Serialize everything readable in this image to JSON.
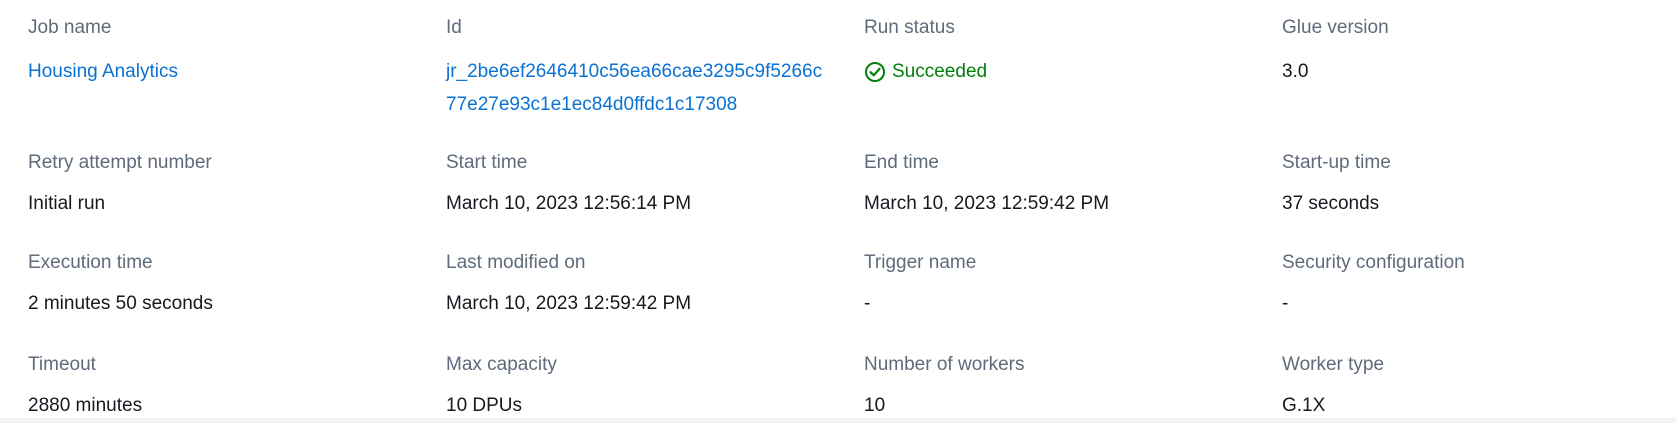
{
  "fields": {
    "job_name": {
      "label": "Job name",
      "value": "Housing Analytics"
    },
    "id": {
      "label": "Id",
      "value": "jr_2be6ef2646410c56ea66cae3295c9f5266c77e27e93c1e1ec84d0ffdc1c17308"
    },
    "run_status": {
      "label": "Run status",
      "value": "Succeeded"
    },
    "glue_version": {
      "label": "Glue version",
      "value": "3.0"
    },
    "retry_attempt": {
      "label": "Retry attempt number",
      "value": "Initial run"
    },
    "start_time": {
      "label": "Start time",
      "value": "March 10, 2023 12:56:14 PM"
    },
    "end_time": {
      "label": "End time",
      "value": "March 10, 2023 12:59:42 PM"
    },
    "startup_time": {
      "label": "Start-up time",
      "value": "37 seconds"
    },
    "execution_time": {
      "label": "Execution time",
      "value": "2 minutes 50 seconds"
    },
    "last_modified": {
      "label": "Last modified on",
      "value": "March 10, 2023 12:59:42 PM"
    },
    "trigger_name": {
      "label": "Trigger name",
      "value": "-"
    },
    "security_config": {
      "label": "Security configuration",
      "value": "-"
    },
    "timeout": {
      "label": "Timeout",
      "value": "2880 minutes"
    },
    "max_capacity": {
      "label": "Max capacity",
      "value": "10 DPUs"
    },
    "num_workers": {
      "label": "Number of workers",
      "value": "10"
    },
    "worker_type": {
      "label": "Worker type",
      "value": "G.1X"
    }
  },
  "icons": {
    "status": "check-circle-icon"
  },
  "colors": {
    "label": "#5f6b7a",
    "value": "#16191f",
    "link": "#0972d3",
    "success": "#037f0c"
  }
}
